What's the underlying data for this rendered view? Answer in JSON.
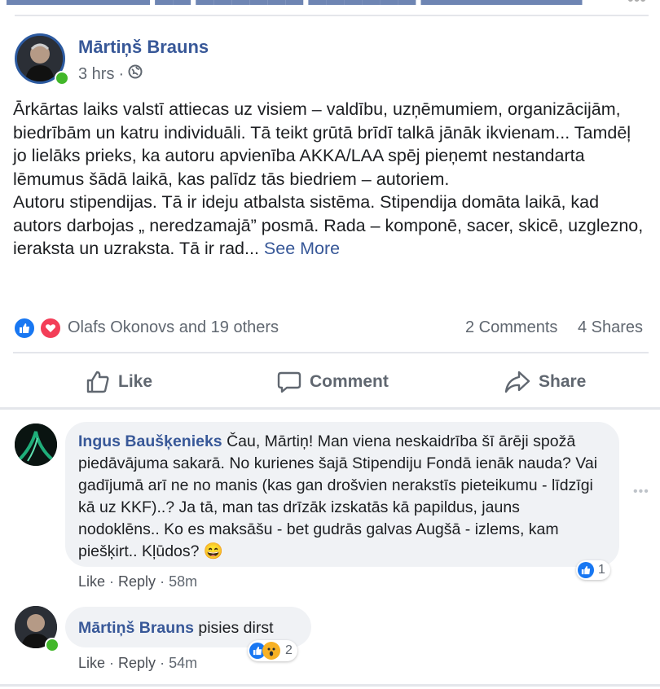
{
  "post": {
    "author": "Mārtiņš Brauns",
    "time": "3 hrs",
    "meta_sep": "·",
    "paragraph1": "Ārkārtas laiks valstī attiecas uz visiem – valdību, uzņēmumiem, organizācijām, biedrībām un katru individuāli. Tā teikt grūtā brīdī talkā jānāk ikvienam... Tamdēļ jo lielāks prieks, ka autoru apvienība AKKA/LAA spēj pieņemt nestandarta lēmumus šādā laikā, kas palīdz tās biedriem – autoriem.",
    "paragraph2": "Autoru stipendijas. Tā ir ideju atbalsta sistēma. Stipendija domāta laikā, kad autors darbojas „ neredzamajā” posmā. Rada – komponē, sacer, skicē, uzglezno, ieraksta un uzraksta. Tā ir rad...",
    "see_more": "See More",
    "reactions_text": "Olafs Okonovs and 19 others",
    "comments_count": "2 Comments",
    "shares_count": "4 Shares"
  },
  "actions": {
    "like": "Like",
    "comment": "Comment",
    "share": "Share"
  },
  "comments": [
    {
      "author": "Ingus Baušķenieks",
      "text": "Čau, Mārtiņ! Man viena neskaidrība šī ārēji spožā piedāvājuma sakarā. No kurienes šajā Stipendiju Fondā ienāk nauda? Vai gadījumā arī ne no manis (kas gan drošvien nerakstīs pieteikumu - līdzīgi kā uz KKF)..? Ja tā, man tas drīzāk izskatās kā papildus, jauns nodoklēns.. Ko es maksāšu - bet gudrās galvas Augšā - izlems, kam piešķirt.. Kļūdos?",
      "emoji": "😄",
      "like": "Like",
      "reply": "Reply",
      "time": "58m",
      "reaction_count": "1"
    },
    {
      "author": "Mārtiņš Brauns",
      "text": "pisies dirst",
      "like": "Like",
      "reply": "Reply",
      "time": "54m",
      "reaction_count": "2"
    }
  ],
  "colors": {
    "link": "#385898",
    "like": "#1877f2",
    "love": "#f33e58",
    "online": "#42b72a"
  },
  "icons": [
    "globe-icon",
    "like-reaction-icon",
    "love-reaction-icon",
    "wow-reaction-icon",
    "thumbs-up-icon",
    "comment-icon",
    "share-icon",
    "more-options-icon"
  ]
}
